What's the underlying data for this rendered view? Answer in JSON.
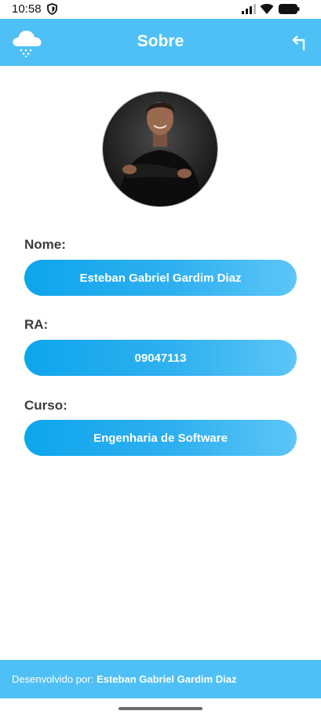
{
  "status_bar": {
    "time": "10:58"
  },
  "app_bar": {
    "title": "Sobre",
    "logo_icon": "cloud-snow-icon",
    "back_icon": "return-arrow-icon"
  },
  "profile": {
    "avatar_icon": "profile-photo"
  },
  "fields": [
    {
      "label": "Nome:",
      "value": "Esteban Gabriel Gardim Diaz"
    },
    {
      "label": "RA:",
      "value": "09047113"
    },
    {
      "label": "Curso:",
      "value": "Engenharia de Software"
    }
  ],
  "footer": {
    "prefix": "Desenvolvido por:",
    "name": "Esteban Gabriel Gardim Diaz"
  },
  "colors": {
    "primary": "#4ec0f5",
    "pill_start": "#0ea5ec",
    "pill_end": "#5cc6f7"
  }
}
